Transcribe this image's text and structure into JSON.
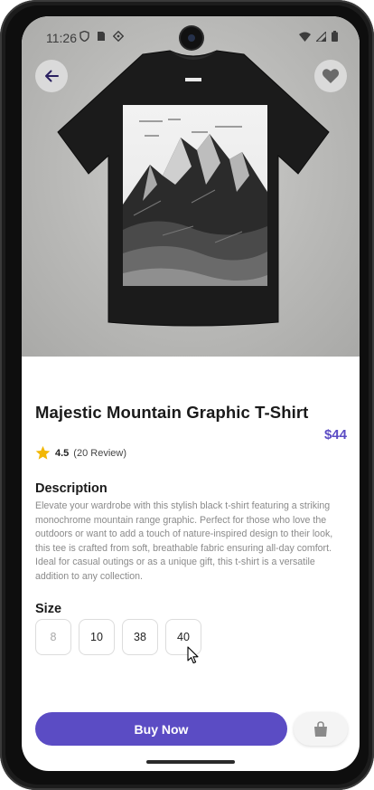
{
  "status_bar": {
    "time": "11:26",
    "left_icons": [
      "shield-icon",
      "sim-icon",
      "diamond-icon"
    ],
    "right_icons": [
      "wifi-icon",
      "signal-icon",
      "battery-icon"
    ]
  },
  "hero": {
    "back_icon": "arrow-left-icon",
    "favorite_icon": "heart-icon",
    "image": "black-t-shirt-mountain-graphic"
  },
  "product": {
    "title": "Majestic Mountain Graphic T-Shirt",
    "price": "$44",
    "rating": "4.5",
    "review_count": "(20 Review)",
    "description_heading": "Description",
    "description": "Elevate your wardrobe with this stylish black t-shirt featuring a striking monochrome mountain range graphic. Perfect for those who love the outdoors or want to add a touch of nature-inspired design to their look, this tee is crafted from soft, breathable fabric ensuring all-day comfort. Ideal for casual outings or as a unique gift, this t-shirt is a versatile addition to any collection.",
    "size_heading": "Size",
    "sizes": [
      "8",
      "10",
      "38",
      "40"
    ]
  },
  "actions": {
    "buy_label": "Buy Now",
    "cart_icon": "shopping-bag-icon"
  },
  "colors": {
    "accent": "#5b4cc4",
    "star": "#f2b705"
  }
}
